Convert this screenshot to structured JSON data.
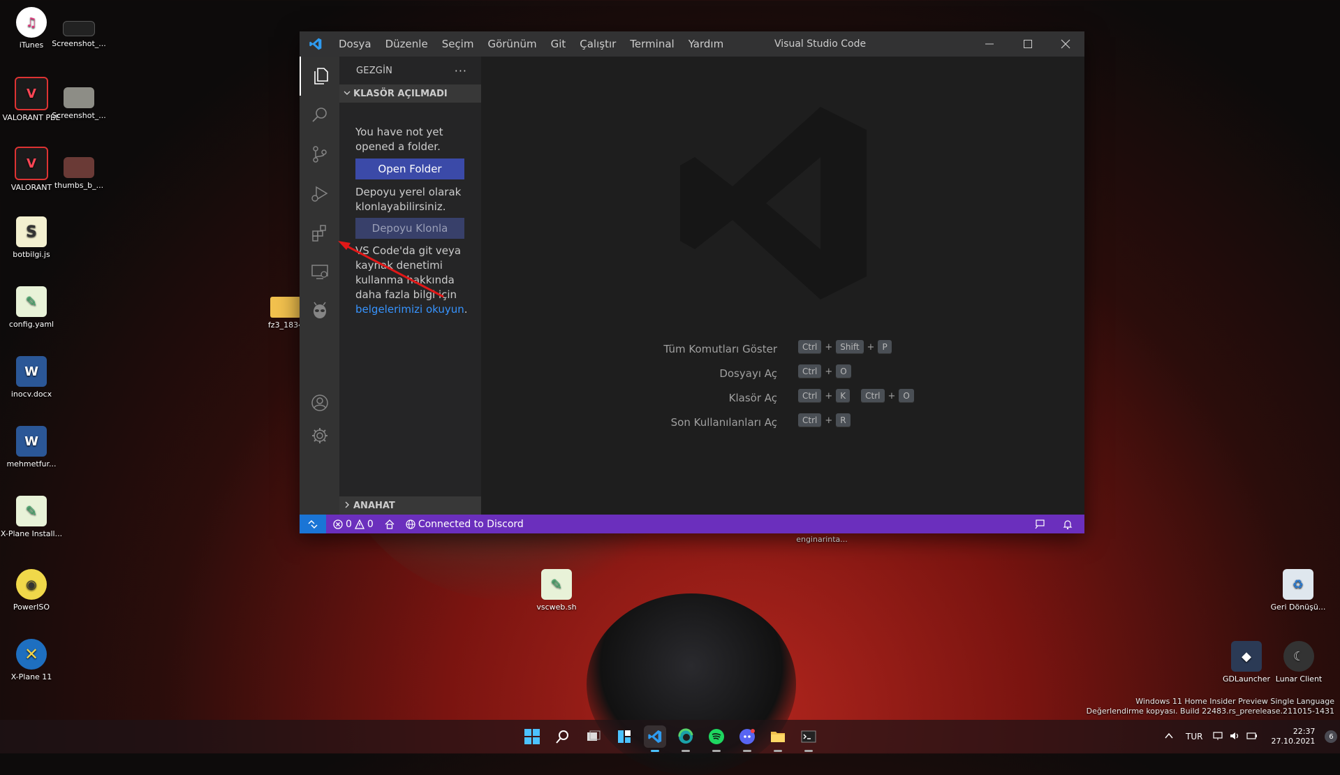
{
  "desktop": {
    "icons": [
      {
        "label": "iTunes"
      },
      {
        "label": "Screenshot_..."
      },
      {
        "label": "VALORANT PBE"
      },
      {
        "label": "Screenshot_..."
      },
      {
        "label": "VALORANT"
      },
      {
        "label": "thumbs_b_..."
      },
      {
        "label": "botbilgi.js"
      },
      {
        "label": "config.yaml"
      },
      {
        "label": "fz3_1834"
      },
      {
        "label": "inocv.docx"
      },
      {
        "label": "mehmetfur..."
      },
      {
        "label": "X-Plane Install..."
      },
      {
        "label": "PowerISO"
      },
      {
        "label": "X-Plane 11"
      },
      {
        "label": "vscweb.sh"
      },
      {
        "label": "enginarinta..."
      },
      {
        "label": "Geri Dönüşü..."
      },
      {
        "label": "GDLauncher"
      },
      {
        "label": "Lunar Client"
      }
    ],
    "windows_watermark": {
      "line1": "Windows 11 Home Insider Preview Single Language",
      "line2": "Değerlendirme kopyası. Build 22483.rs_prerelease.211015-1431"
    }
  },
  "vscode": {
    "menu": [
      "Dosya",
      "Düzenle",
      "Seçim",
      "Görünüm",
      "Git",
      "Çalıştır",
      "Terminal",
      "Yardım"
    ],
    "title": "Visual Studio Code",
    "sidebar": {
      "title": "GEZGİN",
      "more": "···",
      "section_open": "KLASÖR AÇILMADI",
      "no_folder_text": "You have not yet opened a folder.",
      "open_folder_button": "Open Folder",
      "clone_text": "Depoyu yerel olarak klonlayabilirsiniz.",
      "clone_button": "Depoyu Klonla",
      "git_text": "VS Code'da git veya kaynak denetimi kullanma hakkında daha fazla bilgi için ",
      "git_link": "belgelerimizi okuyun",
      "git_tail": ".",
      "outline_section": "ANAHAT"
    },
    "shortcuts": [
      {
        "label": "Tüm Komutları Göster",
        "keys": [
          [
            "Ctrl",
            "Shift",
            "P"
          ]
        ]
      },
      {
        "label": "Dosyayı Aç",
        "keys": [
          [
            "Ctrl",
            "O"
          ]
        ]
      },
      {
        "label": "Klasör Aç",
        "keys": [
          [
            "Ctrl",
            "K"
          ],
          [
            "Ctrl",
            "O"
          ]
        ]
      },
      {
        "label": "Son Kullanılanları Aç",
        "keys": [
          [
            "Ctrl",
            "R"
          ]
        ]
      }
    ],
    "status": {
      "errors": "0",
      "warnings": "0",
      "discord": "Connected to Discord"
    }
  },
  "taskbar": {
    "lang": "TUR",
    "time": "22:37",
    "date": "27.10.2021",
    "notifications": "6"
  }
}
